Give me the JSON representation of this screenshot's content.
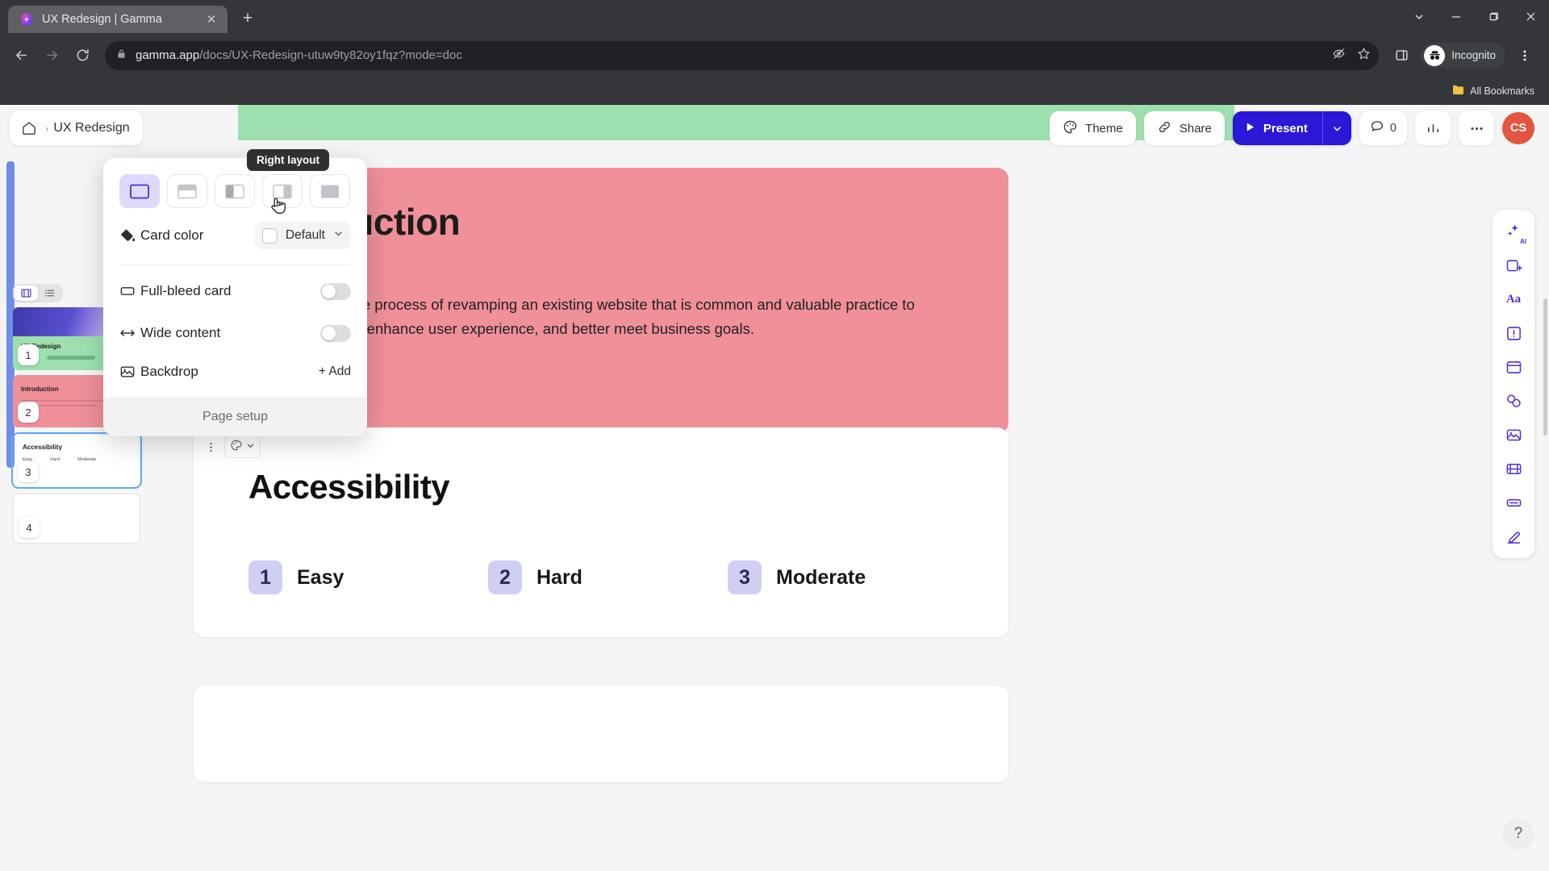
{
  "browser": {
    "tab": {
      "title": "UX Redesign | Gamma",
      "favicon_name": "gamma-logo-icon",
      "close_label": "✕"
    },
    "new_tab_label": "+",
    "window_controls": {
      "minimize": "—",
      "maximize": "❐",
      "close": "✕",
      "tab_search": "⌄"
    },
    "nav": {
      "back": "←",
      "forward": "→",
      "reload": "⟳"
    },
    "omnibox": {
      "url_domain": "gamma.app",
      "url_path": "/docs/UX-Redesign-utuw9ty82oy1fqz?mode=doc",
      "full_url": "gamma.app/docs/UX-Redesign-utuw9ty82oy1fqz?mode=doc",
      "lock_icon": "lock-icon"
    },
    "profile": {
      "label": "Incognito"
    },
    "bookmarks_bar": {
      "label": "All Bookmarks"
    }
  },
  "header": {
    "home_icon": "home-icon",
    "separator": "›",
    "doc_title": "UX Redesign",
    "theme_label": "Theme",
    "share_label": "Share",
    "present_label": "Present",
    "comment_count": "0",
    "avatar_initials": "CS"
  },
  "sidebar": {
    "view_modes": [
      {
        "name": "grid-view",
        "active": true
      },
      {
        "name": "list-view",
        "active": false
      }
    ],
    "slides": [
      {
        "number": "1",
        "title": "UX Redesign",
        "color": "#9de0ae",
        "selected": false
      },
      {
        "number": "2",
        "title": "Introduction",
        "color": "#f09099",
        "selected": false
      },
      {
        "number": "3",
        "title": "Accessibility",
        "color": "#ffffff",
        "selected": true
      },
      {
        "number": "4",
        "title": "",
        "color": "#ffffff",
        "selected": false
      }
    ]
  },
  "popover": {
    "tooltip": "Right layout",
    "layouts": [
      {
        "name": "full-layout",
        "active": true
      },
      {
        "name": "top-layout",
        "active": false
      },
      {
        "name": "left-layout",
        "active": false
      },
      {
        "name": "right-layout",
        "active": false
      },
      {
        "name": "background-layout",
        "active": false
      }
    ],
    "card_color": {
      "label": "Card color",
      "value": "Default",
      "icon": "paint-bucket-icon",
      "caret": "⌄"
    },
    "full_bleed": {
      "label": "Full-bleed card",
      "icon": "card-icon",
      "enabled": false
    },
    "wide_content": {
      "label": "Wide content",
      "icon": "arrows-horizontal-icon",
      "enabled": false
    },
    "backdrop": {
      "label": "Backdrop",
      "icon": "image-icon",
      "action": "+ Add"
    },
    "footer_label": "Page setup"
  },
  "canvas": {
    "intro_card": {
      "title": "Introduction",
      "body": "UX redesign is the process of revamping an existing website that is common and valuable practice to improve usability, enhance user experience, and better meet business goals."
    },
    "accessibility_card": {
      "title": "Accessibility",
      "toolbar": {
        "more_icon": "kebab-menu-icon",
        "palette_icon": "palette-icon",
        "caret": "⌄"
      },
      "items": [
        {
          "number": "1",
          "label": "Easy"
        },
        {
          "number": "2",
          "label": "Hard"
        },
        {
          "number": "3",
          "label": "Moderate"
        }
      ]
    }
  },
  "rail": {
    "buttons": [
      {
        "name": "ai-icon",
        "label": "AI"
      },
      {
        "name": "add-card-icon",
        "label": ""
      },
      {
        "name": "text-icon",
        "label": "Aa"
      },
      {
        "name": "callout-icon",
        "label": ""
      },
      {
        "name": "layout-icon",
        "label": ""
      },
      {
        "name": "shapes-icon",
        "label": ""
      },
      {
        "name": "image-icon",
        "label": ""
      },
      {
        "name": "video-icon",
        "label": ""
      },
      {
        "name": "embed-icon",
        "label": ""
      },
      {
        "name": "draw-icon",
        "label": ""
      }
    ],
    "help_label": "?"
  },
  "colors": {
    "accent": "#2b17d6",
    "pink_card": "#f09099",
    "green_header": "#9de0ae",
    "purple_active": "#ddd9fb",
    "selection_blue": "#61a9f0"
  }
}
